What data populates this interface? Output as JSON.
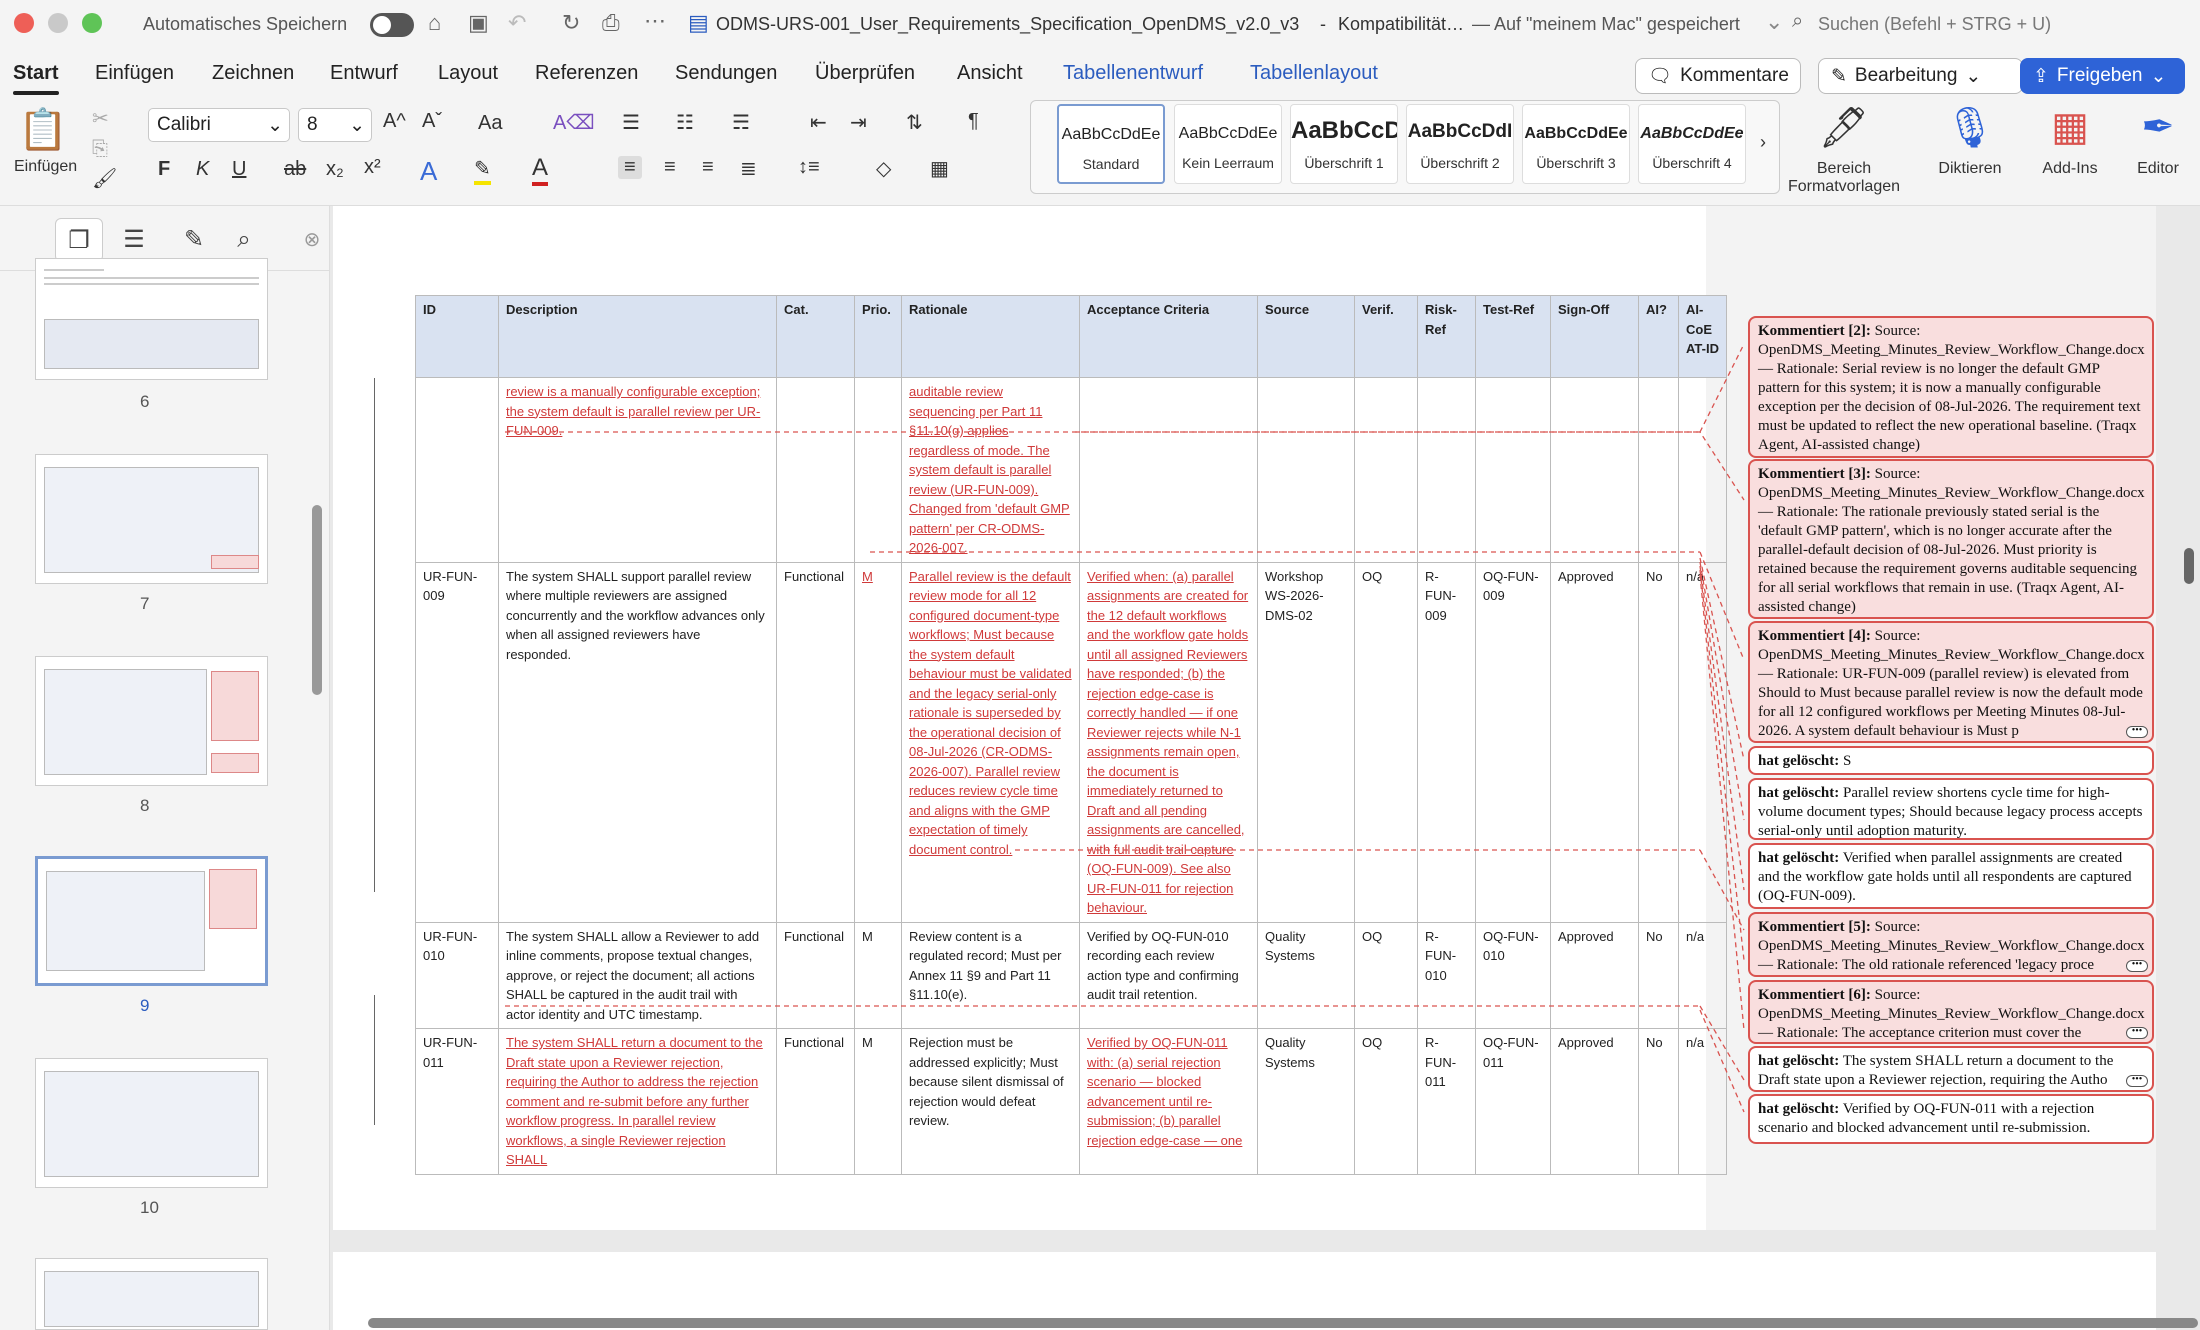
{
  "titlebar": {
    "autosave_label": "Automatisches Speichern",
    "doc_title": "ODMS-URS-001_User_Requirements_Specification_OpenDMS_v2.0_v3",
    "separator": "-",
    "mode": "Kompatibilität…",
    "saved_status": "— Auf \"meinem Mac\" gespeichert",
    "search_placeholder": "Suchen (Befehl + STRG + U)"
  },
  "menu": {
    "items": [
      "Start",
      "Einfügen",
      "Zeichnen",
      "Entwurf",
      "Layout",
      "Referenzen",
      "Sendungen",
      "Überprüfen",
      "Ansicht",
      "Tabellenentwurf",
      "Tabellenlayout"
    ],
    "comments_button": "Kommentare",
    "edit_button": "Bearbeitung",
    "share_button": "Freigeben"
  },
  "ribbon": {
    "paste_label": "Einfügen",
    "font_name": "Calibri",
    "font_size": "8",
    "bold": "F",
    "italic": "K",
    "underline": "U",
    "strike": "ab",
    "sub": "x₂",
    "sup": "x²",
    "case": "Aa",
    "styles": [
      {
        "preview": "AaBbCcDdEe",
        "name": "Standard"
      },
      {
        "preview": "AaBbCcDdEe",
        "name": "Kein Leerraum"
      },
      {
        "preview": "AaBbCcD",
        "name": "Überschrift 1"
      },
      {
        "preview": "AaBbCcDdI",
        "name": "Überschrift 2"
      },
      {
        "preview": "AaBbCcDdEe",
        "name": "Überschrift 3"
      },
      {
        "preview": "AaBbCcDdEe",
        "name": "Überschrift 4"
      }
    ],
    "format_pane": "Bereich\nFormatvorlagen",
    "dictate": "Diktieren",
    "addins": "Add-Ins",
    "editor": "Editor"
  },
  "sidebar": {
    "pages": [
      "6",
      "7",
      "8",
      "9",
      "10"
    ],
    "selected_page": "9"
  },
  "table": {
    "headers": [
      "ID",
      "Description",
      "Cat.",
      "Prio.",
      "Rationale",
      "Acceptance Criteria",
      "Source",
      "Verif.",
      "Risk-Ref",
      "Test-Ref",
      "Sign-Off",
      "AI?",
      "AI-CoE AT-ID"
    ],
    "rows": [
      {
        "id": "",
        "desc": "review is a manually configurable exception; the system default is parallel review per UR-FUN-009.",
        "desc_ins": true,
        "cat": "",
        "prio": "",
        "rationale": "auditable review sequencing per Part 11 §11.10(g) applies regardless of mode. The system default is parallel review (UR-FUN-009). Changed from 'default GMP pattern' per CR-ODMS-2026-007.",
        "rat_ins": true,
        "acc": "",
        "acc_ins": false,
        "source": "",
        "verif": "",
        "risk": "",
        "test": "",
        "sign": "",
        "ai": "",
        "atid": ""
      },
      {
        "id": "UR-FUN-009",
        "desc": "The system SHALL support parallel review where multiple reviewers are assigned concurrently and the workflow advances only when all assigned reviewers have responded.",
        "desc_ins": false,
        "cat": "Functional",
        "prio": "M",
        "prio_ins": true,
        "rationale": "Parallel review is the default review mode for all 12 configured document-type workflows; Must because the system default behaviour must be validated and the legacy serial-only rationale is superseded by the operational decision of 08-Jul-2026 (CR-ODMS-2026-007). Parallel review reduces review cycle time and aligns with the GMP expectation of timely document control.",
        "rat_ins": true,
        "acc": "Verified when: (a) parallel assignments are created for the 12 default workflows and the workflow gate holds until all assigned Reviewers have responded; (b) the rejection edge-case is correctly handled — if one Reviewer rejects while N-1 assignments remain open, the document is immediately returned to Draft and all pending assignments are cancelled, with full audit trail capture (OQ-FUN-009). See also UR-FUN-011 for rejection behaviour.",
        "acc_ins": true,
        "source": "Workshop WS-2026-DMS-02",
        "verif": "OQ",
        "risk": "R-FUN-009",
        "test": "OQ-FUN-009",
        "sign": "Approved",
        "ai": "No",
        "atid": "n/a"
      },
      {
        "id": "UR-FUN-010",
        "desc": "The system SHALL allow a Reviewer to add inline comments, propose textual changes, approve, or reject the document; all actions SHALL be captured in the audit trail with actor identity and UTC timestamp.",
        "desc_ins": false,
        "cat": "Functional",
        "prio": "M",
        "rationale": "Review content is a regulated record; Must per Annex 11 §9 and Part 11 §11.10(e).",
        "rat_ins": false,
        "acc": "Verified by OQ-FUN-010 recording each review action type and confirming audit trail retention.",
        "acc_ins": false,
        "source": "Quality Systems",
        "verif": "OQ",
        "risk": "R-FUN-010",
        "test": "OQ-FUN-010",
        "sign": "Approved",
        "ai": "No",
        "atid": "n/a"
      },
      {
        "id": "UR-FUN-011",
        "desc": "The system SHALL return a document to the Draft state upon a Reviewer rejection, requiring the Author to address the rejection comment and re-submit before any further workflow progress. In parallel review workflows, a single Reviewer rejection SHALL",
        "desc_ins": true,
        "cat": "Functional",
        "prio": "M",
        "rationale": "Rejection must be addressed explicitly; Must because silent dismissal of rejection would defeat review.",
        "rat_ins": false,
        "acc": "Verified by OQ-FUN-011 with: (a) serial rejection scenario — blocked advancement until re-submission; (b) parallel rejection edge-case — one",
        "acc_ins": true,
        "source": "Quality Systems",
        "verif": "OQ",
        "risk": "R-FUN-011",
        "test": "OQ-FUN-011",
        "sign": "Approved",
        "ai": "No",
        "atid": "n/a"
      }
    ]
  },
  "comments": [
    {
      "label": "Kommentiert [2]:",
      "text": "Source: OpenDMS_Meeting_Minutes_Review_Workflow_Change.docx — Rationale: Serial review is no longer the default GMP pattern for this system; it is now a manually configurable exception per the decision of 08-Jul-2026. The requirement text must be updated to reflect the new operational baseline. (Traqx Agent, AI-assisted change)",
      "pink": true
    },
    {
      "label": "Kommentiert [3]:",
      "text": "Source: OpenDMS_Meeting_Minutes_Review_Workflow_Change.docx — Rationale: The rationale previously stated serial is the 'default GMP pattern', which is no longer accurate after the parallel-default decision of 08-Jul-2026. Must priority is retained because the requirement governs auditable sequencing for all serial workflows that remain in use. (Traqx Agent, AI-assisted change)",
      "pink": true
    },
    {
      "label": "Kommentiert [4]:",
      "text": "Source: OpenDMS_Meeting_Minutes_Review_Workflow_Change.docx — Rationale: UR-FUN-009 (parallel review) is elevated from Should to Must because parallel review is now the default mode for all 12 configured workflows per Meeting Minutes 08-Jul-2026. A system default behaviour is Must p",
      "pink": true
    },
    {
      "label": "hat gelöscht:",
      "text": "S",
      "pink": false
    },
    {
      "label": "hat gelöscht:",
      "text": "Parallel review shortens cycle time for high-volume document types; Should because legacy process accepts serial-only until adoption maturity.",
      "pink": false
    },
    {
      "label": "hat gelöscht:",
      "text": "Verified when parallel assignments are created and the workflow gate holds until all respondents are captured (OQ-FUN-009).",
      "pink": false
    },
    {
      "label": "Kommentiert [5]:",
      "text": "Source: OpenDMS_Meeting_Minutes_Review_Workflow_Change.docx — Rationale: The old rationale referenced 'legacy proce",
      "pink": true
    },
    {
      "label": "Kommentiert [6]:",
      "text": "Source: OpenDMS_Meeting_Minutes_Review_Workflow_Change.docx — Rationale: The acceptance criterion must cover the",
      "pink": true
    },
    {
      "label": "hat gelöscht:",
      "text": "The system SHALL return a document to the Draft state upon a Reviewer rejection, requiring the Autho",
      "pink": false
    },
    {
      "label": "hat gelöscht:",
      "text": "Verified by OQ-FUN-011 with a rejection scenario and blocked advancement until re-submission.",
      "pink": false
    }
  ],
  "colors": {
    "accent": "#2e63d7",
    "insert": "#d03a3a",
    "comment_border": "#d9534f",
    "header_fill": "#d9e2f1"
  }
}
